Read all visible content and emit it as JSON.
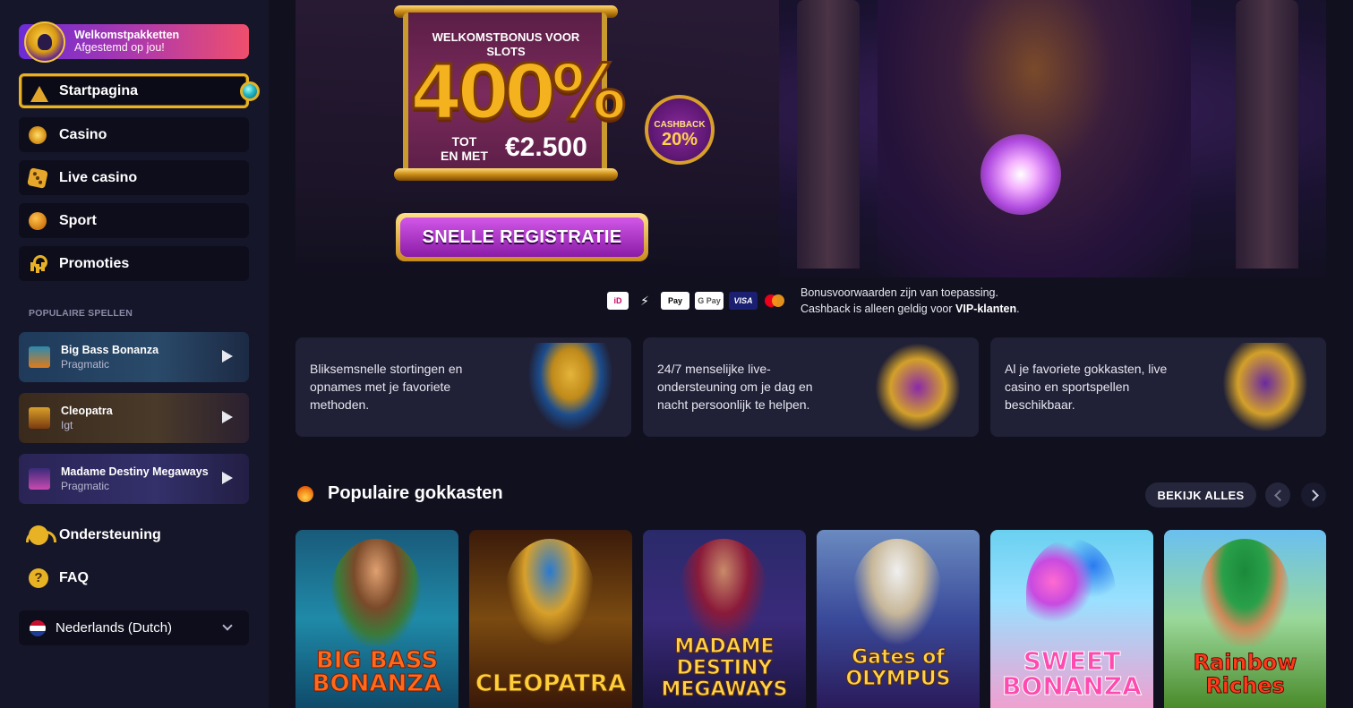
{
  "sidebar": {
    "welcome": {
      "title": "Welkomstpakketten",
      "subtitle": "Afgestemd op jou!"
    },
    "nav": [
      {
        "label": "Startpagina",
        "icon": "pyramid-icon",
        "active": true
      },
      {
        "label": "Casino",
        "icon": "casino-chip-icon"
      },
      {
        "label": "Live casino",
        "icon": "dice-icon"
      },
      {
        "label": "Sport",
        "icon": "ball-icon"
      },
      {
        "label": "Promoties",
        "icon": "ankh-icon"
      }
    ],
    "popular_label": "POPULAIRE SPELLEN",
    "games": [
      {
        "name": "Big Bass Bonanza",
        "provider": "Pragmatic"
      },
      {
        "name": "Cleopatra",
        "provider": "Igt"
      },
      {
        "name": "Madame Destiny Megaways",
        "provider": "Pragmatic"
      }
    ],
    "support_label": "Ondersteuning",
    "faq_label": "FAQ",
    "faq_glyph": "?",
    "language": "Nederlands (Dutch)"
  },
  "hero": {
    "bonus_title": "WELKOMSTBONUS VOOR SLOTS",
    "bonus_percent": "400%",
    "bonus_tot": "TOT",
    "bonus_en_met": "EN MET",
    "bonus_amount": "€2.500",
    "cashback_label": "CASHBACK",
    "cashback_value": "20%",
    "register_button": "SNELLE REGISTRATIE"
  },
  "payments": {
    "methods": [
      "iDEAL",
      "Bank",
      "Apple Pay",
      "G Pay",
      "VISA",
      "Mastercard"
    ],
    "labels": {
      "ideal": "iD",
      "bank": "⚡",
      "apple": "Pay",
      "google": "G Pay",
      "visa": "VISA"
    },
    "terms_line1": "Bonusvoorwaarden zijn van toepassing.",
    "terms_line2_prefix": "Cashback is alleen geldig voor ",
    "terms_line2_bold": "VIP-klanten",
    "terms_line2_suffix": "."
  },
  "features": [
    {
      "text": "Bliksemsnelle stortingen en opnames met je favoriete methoden."
    },
    {
      "text": "24/7 menselijke live-ondersteuning om je dag en nacht persoonlijk te helpen."
    },
    {
      "text": "Al je favoriete gokkasten, live casino en sportspellen beschikbaar."
    }
  ],
  "popular_slots": {
    "title": "Populaire gokkasten",
    "view_all": "BEKIJK ALLES",
    "tiles": [
      {
        "label": "BIG BASS BONANZA"
      },
      {
        "label": "CLEOPATRA"
      },
      {
        "label": "MADAME DESTINY MEGAWAYS"
      },
      {
        "label": "Gates of OLYMPUS"
      },
      {
        "label": "SWEET BONANZA"
      },
      {
        "label": "Rainbow Riches"
      }
    ]
  },
  "colors": {
    "background": "#11101f",
    "sidebar": "#16162a",
    "accent_gold": "#e7b324",
    "card": "#202036"
  }
}
